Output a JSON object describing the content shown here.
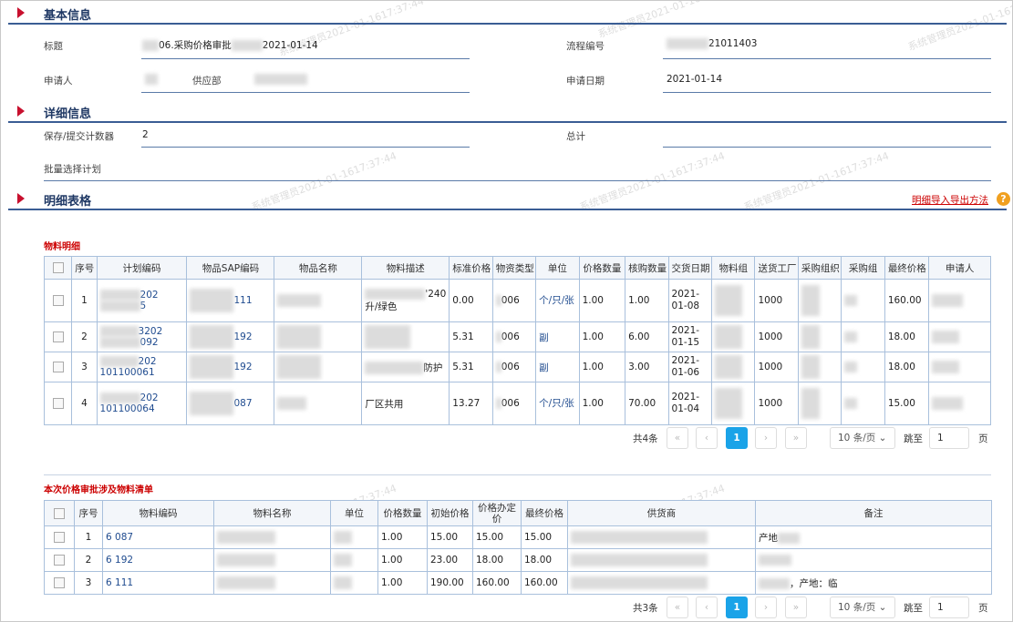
{
  "sections": {
    "basic": "基本信息",
    "detail": "详细信息",
    "table": "明细表格"
  },
  "basic": {
    "title_label": "标题",
    "title_value": "06.采购价格审批",
    "title_date": "2021-01-14",
    "flow_label": "流程编号",
    "flow_value": "21011403",
    "applicant_label": "申请人",
    "dept_label": "供应部",
    "date_label": "申请日期",
    "date_value": "2021-01-14"
  },
  "detail": {
    "save_label": "保存/提交计数器",
    "save_value": "2",
    "total_label": "总计",
    "batch_label": "批量选择计划"
  },
  "import_link": "明细导入导出方法",
  "material": {
    "title": "物料明细",
    "headers": [
      "序号",
      "计划编码",
      "物品SAP编码",
      "物品名称",
      "物料描述",
      "标准价格",
      "物资类型",
      "单位",
      "价格数量",
      "核购数量",
      "交货日期",
      "物料组",
      "送货工厂",
      "采购组织",
      "采购组",
      "最终价格",
      "申请人"
    ],
    "rows": [
      {
        "no": "1",
        "plan": "202",
        "plan2": "5",
        "sap": "111",
        "desc": "'240",
        "desc2": "升/绿色",
        "std": "0.00",
        "type": "006",
        "unit": "个/只/张",
        "pqty": "1.00",
        "qty": "1.00",
        "date": "2021-01-08",
        "plant": "1000",
        "final": "160.00"
      },
      {
        "no": "2",
        "plan": "3202",
        "plan2": "092",
        "sap": "192",
        "desc": "",
        "desc2": "",
        "std": "5.31",
        "type": "006",
        "unit": "副",
        "pqty": "1.00",
        "qty": "6.00",
        "date": "2021-01-15",
        "plant": "1000",
        "final": "18.00"
      },
      {
        "no": "3",
        "plan": "202",
        "plan2": "101100061",
        "sap": "192",
        "desc": "防护",
        "desc2": "",
        "std": "5.31",
        "type": "006",
        "unit": "副",
        "pqty": "1.00",
        "qty": "3.00",
        "date": "2021-01-06",
        "plant": "1000",
        "final": "18.00"
      },
      {
        "no": "4",
        "plan": "202",
        "plan2": "101100064",
        "sap": "087",
        "desc": "厂区共用",
        "desc2": "",
        "std": "13.27",
        "type": "006",
        "unit": "个/只/张",
        "pqty": "1.00",
        "qty": "70.00",
        "date": "2021-01-04",
        "plant": "1000",
        "final": "15.00"
      }
    ],
    "pager": {
      "total": "共4条",
      "page": "1",
      "size": "10 条/页",
      "goto": "跳至",
      "goto_val": "1",
      "page_unit": "页"
    }
  },
  "price": {
    "title": "本次价格审批涉及物料清单",
    "headers": [
      "序号",
      "物料编码",
      "物料名称",
      "单位",
      "价格数量",
      "初始价格",
      "价格办定价",
      "最终价格",
      "供货商",
      "备注"
    ],
    "rows": [
      {
        "no": "1",
        "code": "6 087",
        "qty": "1.00",
        "init": "15.00",
        "set": "15.00",
        "final": "15.00",
        "note": "产地"
      },
      {
        "no": "2",
        "code": "6 192",
        "qty": "1.00",
        "init": "23.00",
        "set": "18.00",
        "final": "18.00",
        "note": ""
      },
      {
        "no": "3",
        "code": "6 111",
        "qty": "1.00",
        "init": "190.00",
        "set": "160.00",
        "final": "160.00",
        "note": "，产地：临"
      }
    ],
    "pager": {
      "total": "共3条",
      "page": "1",
      "size": "10 条/页",
      "goto": "跳至",
      "goto_val": "1",
      "page_unit": "页"
    }
  },
  "watermark": "系统管理员2021-01-1617:37:44",
  "icons": {
    "section": "triangle-right-icon",
    "help": "question-icon",
    "prev": "chevron-left-icon",
    "next": "chevron-right-icon",
    "first": "double-chevron-left-icon",
    "last": "double-chevron-right-icon",
    "dropdown": "chevron-down-icon"
  },
  "colors": {
    "accent": "#1aa3e8",
    "section": "#1f3864",
    "marker": "#c8102e",
    "required": "#cc0000"
  }
}
